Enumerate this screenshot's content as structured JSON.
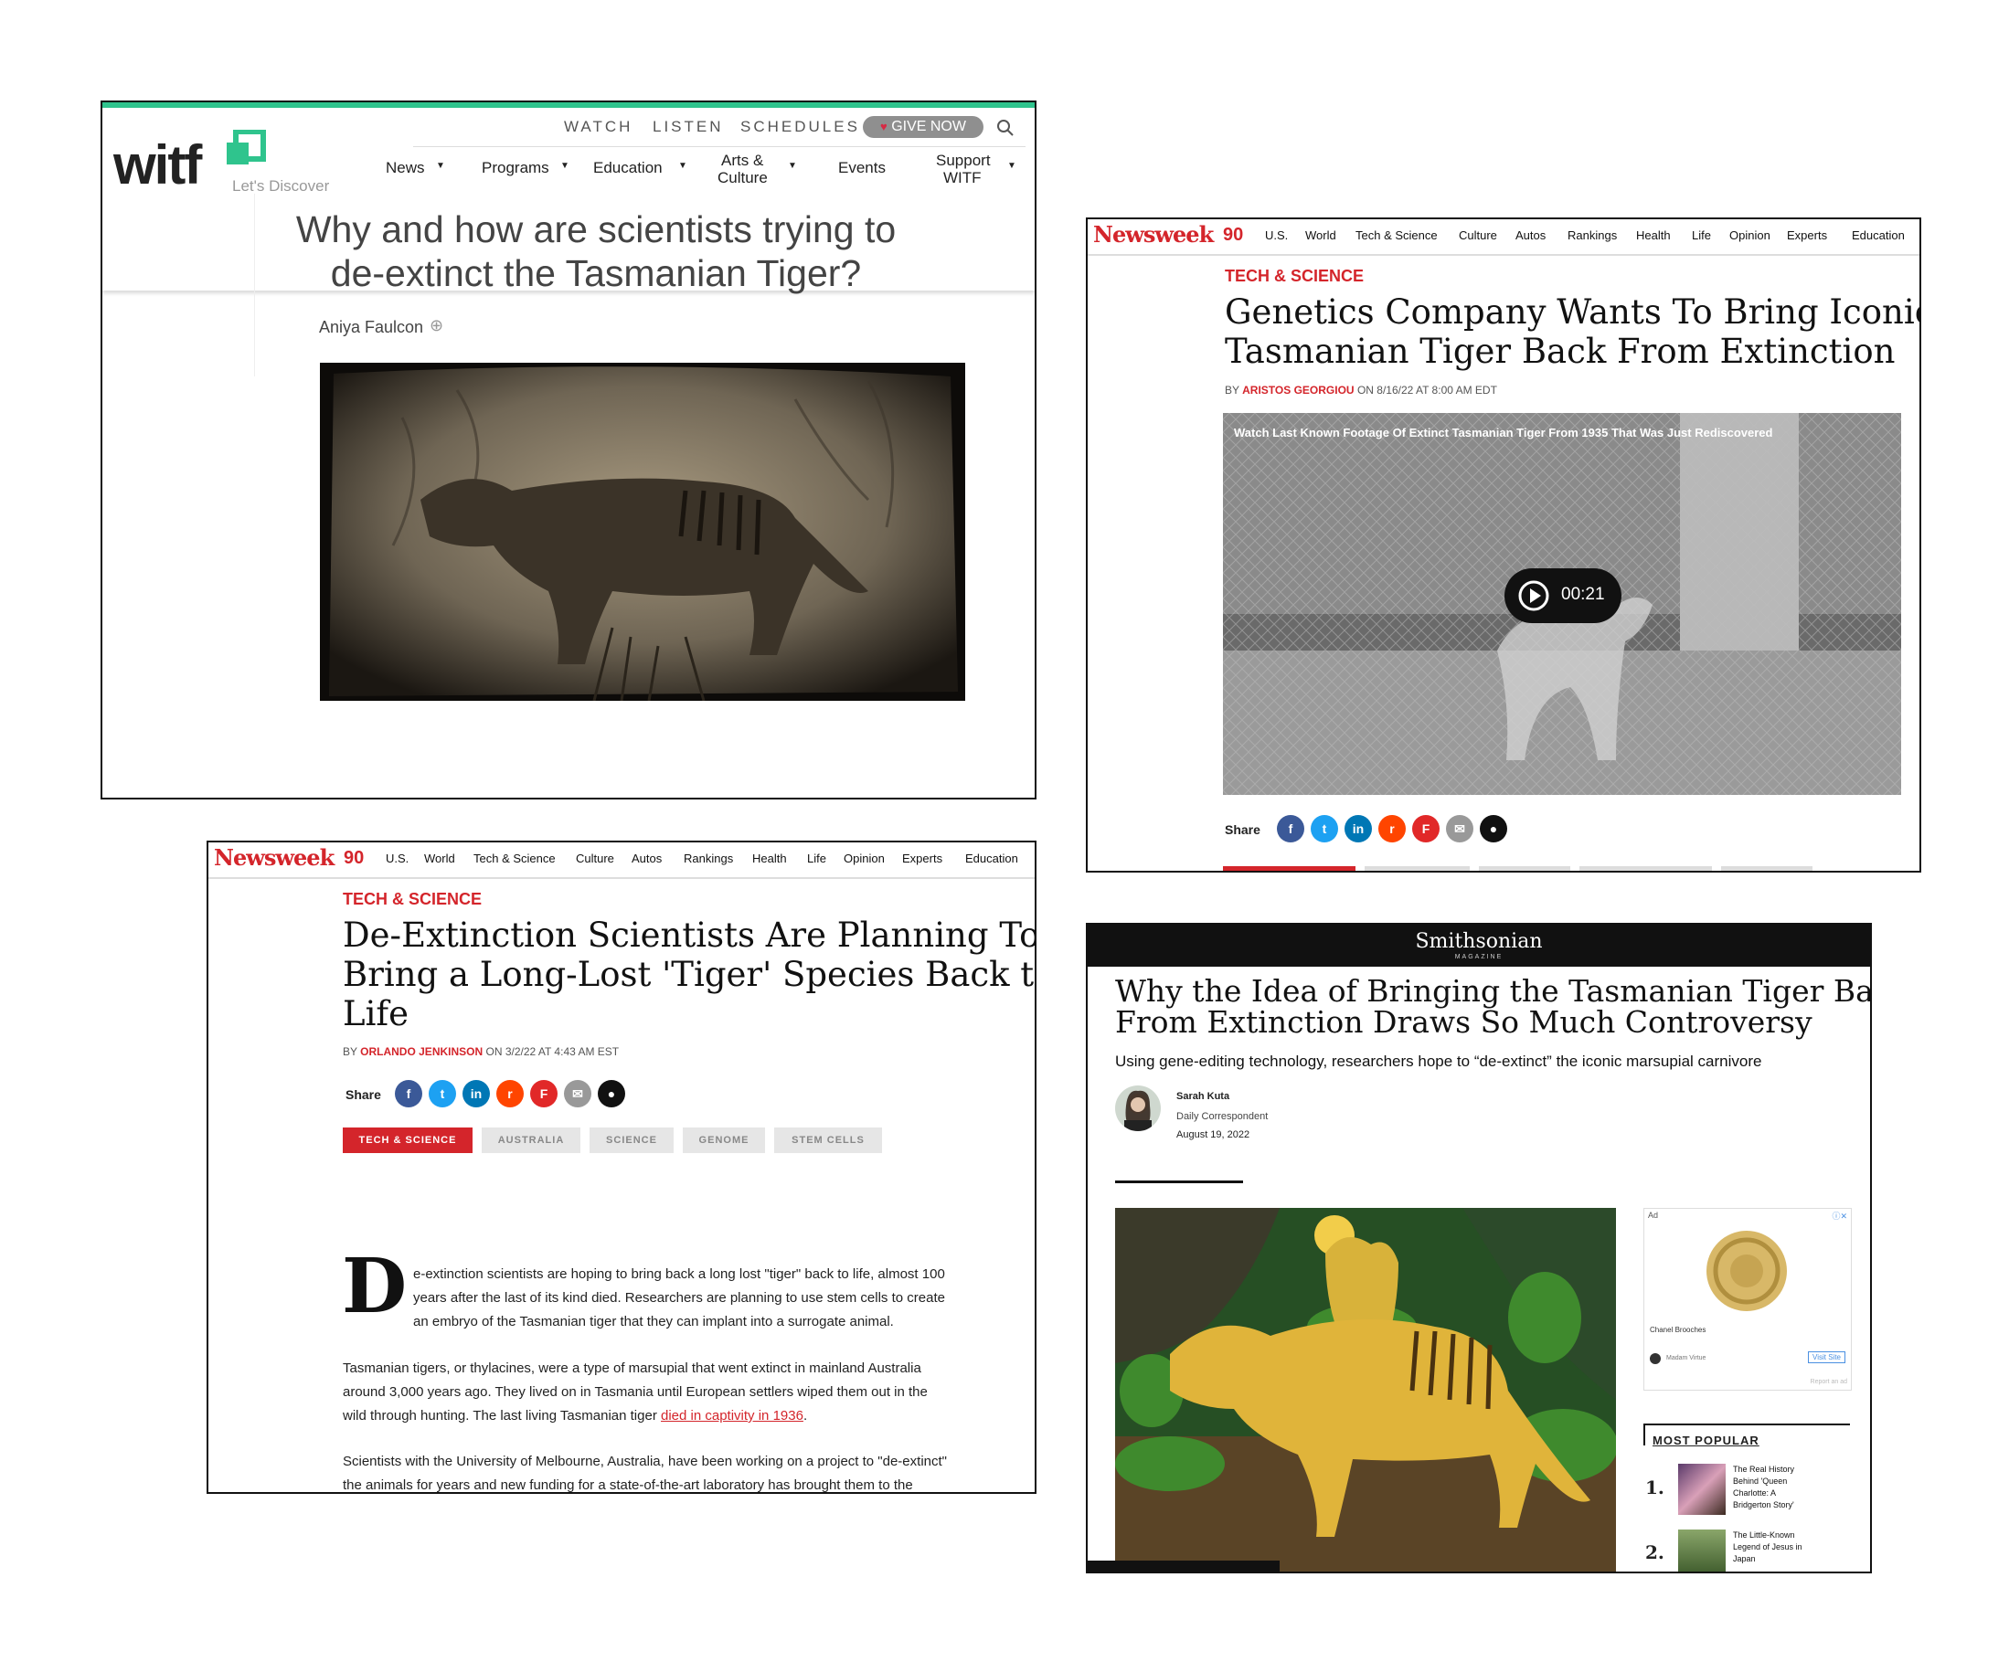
{
  "witf": {
    "logo_text": "witf",
    "tagline": "Let's Discover",
    "top_nav": [
      "WATCH",
      "LISTEN",
      "SCHEDULES"
    ],
    "give_now": "GIVE NOW",
    "main_nav": [
      "News",
      "Programs",
      "Education",
      "Arts &",
      "Culture",
      "Events",
      "Support",
      "WITF"
    ],
    "title_line1": "Why and how are scientists trying to",
    "title_line2": "de-extinct the Tasmanian Tiger?",
    "author": "Aniya Faulcon",
    "colors": {
      "accent": "#2fc48d",
      "button": "#8f8f8f"
    }
  },
  "nw1": {
    "logo": "Newsweek",
    "badge": "90",
    "nav": [
      "U.S.",
      "World",
      "Tech & Science",
      "Culture",
      "Autos",
      "Rankings",
      "Health",
      "Life",
      "Opinion",
      "Experts",
      "Education"
    ],
    "kicker": "TECH & SCIENCE",
    "title_line1": "Genetics Company Wants To Bring Iconic",
    "title_line2": "Tasmanian Tiger Back From Extinction",
    "by": "BY",
    "author": "ARISTOS GEORGIOU",
    "date": "ON 8/16/22 AT 8:00 AM EDT",
    "video_caption": "Watch Last Known Footage Of Extinct Tasmanian Tiger From 1935 That Was Just Rediscovered",
    "video_duration": "00:21",
    "share_label": "Share"
  },
  "nw2": {
    "logo": "Newsweek",
    "badge": "90",
    "nav": [
      "U.S.",
      "World",
      "Tech & Science",
      "Culture",
      "Autos",
      "Rankings",
      "Health",
      "Life",
      "Opinion",
      "Experts",
      "Education"
    ],
    "kicker": "TECH & SCIENCE",
    "title_line1": "De-Extinction Scientists Are Planning To",
    "title_line2": "Bring a Long-Lost 'Tiger' Species Back to",
    "title_line3": "Life",
    "by": "BY",
    "author": "ORLANDO JENKINSON",
    "date": "ON 3/2/22 AT 4:43 AM EST",
    "share_label": "Share",
    "tags": [
      "TECH & SCIENCE",
      "AUSTRALIA",
      "SCIENCE",
      "GENOME",
      "STEM CELLS"
    ],
    "dropcap": "D",
    "p1_line1": "e-extinction scientists are hoping to bring back a long lost \"tiger\" back to life, almost 100",
    "p1_line2": "years after the last of its kind died. Researchers are planning to use stem cells to create",
    "p1_line3": "an embryo of the Tasmanian tiger that they can implant into a surrogate animal.",
    "p2_line1": "Tasmanian tigers, or thylacines, were a type of marsupial that went extinct in mainland Australia",
    "p2_line2": "around 3,000 years ago. They lived on in Tasmania until European settlers wiped them out in the",
    "p2_line3": "wild through hunting. The last living Tasmanian tiger",
    "p2_link": "died in captivity in 1936",
    "p2_end": ".",
    "p3_line1": "Scientists with the University of Melbourne, Australia, have been working on a project to \"de-extinct\"",
    "p3_line2": "the animals for years and new funding for a state-of-the-art laboratory has brought them to the"
  },
  "smith": {
    "logo": "Smithsonian",
    "logo_sub": "MAGAZINE",
    "title_line1": "Why the Idea of Bringing the Tasmanian Tiger Back",
    "title_line2": "From Extinction Draws So Much Controversy",
    "subtitle": "Using gene-editing technology, researchers hope to “de-extinct” the iconic marsupial carnivore",
    "author": "Sarah Kuta",
    "role": "Daily Correspondent",
    "date": "August 19, 2022",
    "ad_label": "Ad",
    "ad_product": "Chanel Brooches",
    "ad_brand": "Madam Virtue",
    "ad_button": "Visit Site",
    "ad_report": "Report an ad",
    "most_popular": "MOST POPULAR",
    "popular": [
      {
        "num": "1.",
        "l1": "The Real History",
        "l2": "Behind 'Queen",
        "l3": "Charlotte: A",
        "l4": "Bridgerton Story'"
      },
      {
        "num": "2.",
        "l1": "The Little-Known",
        "l2": "Legend of Jesus in",
        "l3": "Japan",
        "l4": ""
      }
    ]
  }
}
